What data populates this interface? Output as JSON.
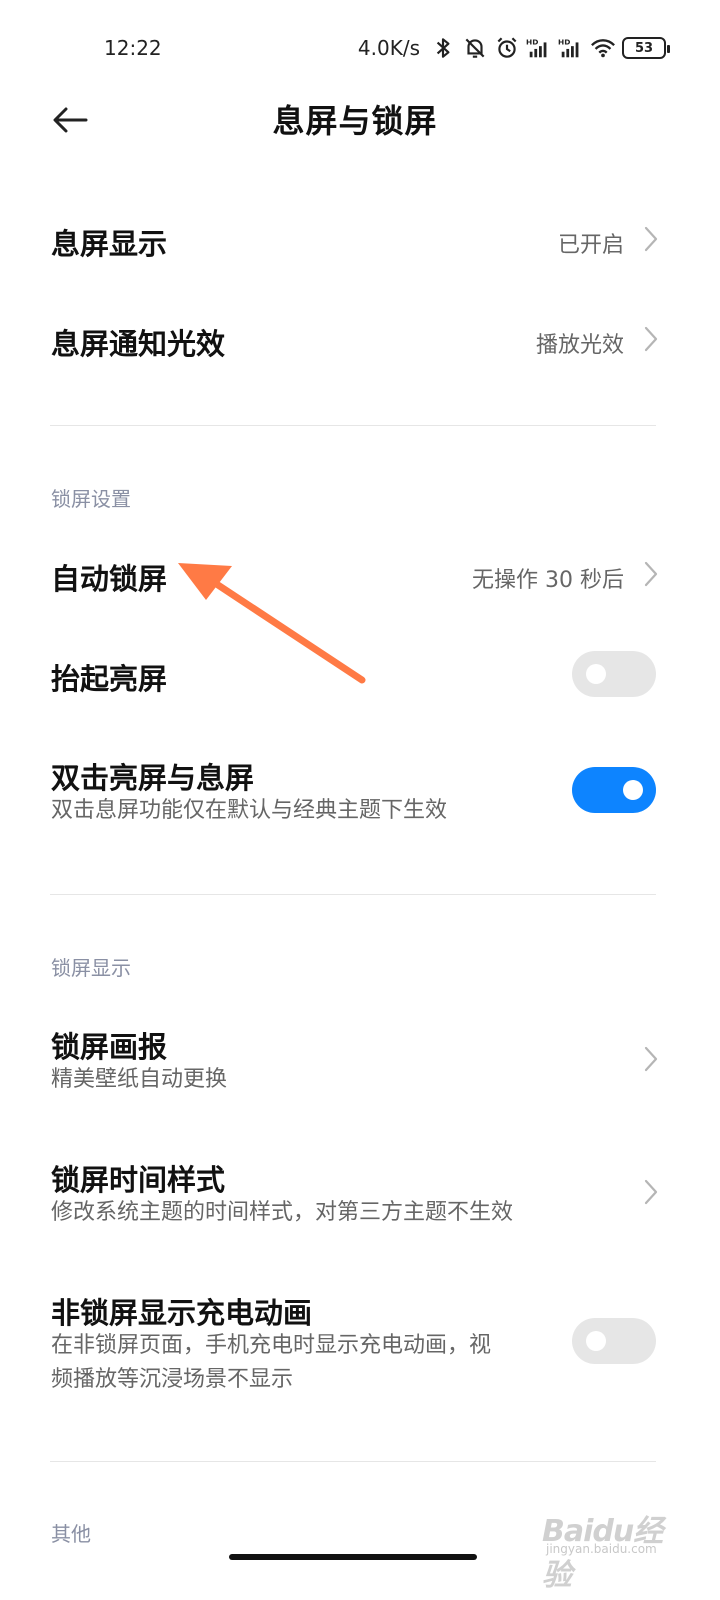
{
  "status_bar": {
    "time": "12:22",
    "net_speed": "4.0K/s",
    "battery": "53",
    "icons": [
      "bluetooth-icon",
      "vibrate-mute-icon",
      "alarm-icon",
      "signal-hd-1-icon",
      "signal-hd-2-icon",
      "wifi-icon"
    ]
  },
  "header": {
    "back_icon": "arrow-left-icon",
    "title": "息屏与锁屏"
  },
  "sections": {
    "aod": {
      "items": [
        {
          "title": "息屏显示",
          "value": "已开启"
        },
        {
          "title": "息屏通知光效",
          "value": "播放光效"
        }
      ]
    },
    "lock_settings": {
      "header": "锁屏设置",
      "items": [
        {
          "title": "自动锁屏",
          "value": "无操作 30 秒后"
        },
        {
          "title": "抬起亮屏",
          "toggle": false
        },
        {
          "title": "双击亮屏与息屏",
          "subtitle": "双击息屏功能仅在默认与经典主题下生效",
          "toggle": true
        }
      ]
    },
    "lock_display": {
      "header": "锁屏显示",
      "items": [
        {
          "title": "锁屏画报",
          "subtitle": "精美壁纸自动更换"
        },
        {
          "title": "锁屏时间样式",
          "subtitle": "修改系统主题的时间样式，对第三方主题不生效"
        },
        {
          "title": "非锁屏显示充电动画",
          "subtitle_line1": "在非锁屏页面，手机充电时显示充电动画，视",
          "subtitle_line2": "频播放等沉浸场景不显示",
          "toggle": false
        }
      ]
    },
    "other": {
      "header": "其他"
    }
  },
  "colors": {
    "accent": "#0d84ff",
    "annotation_arrow": "#ff7a45",
    "section_header": "#8a90a4",
    "toggle_off": "#e6e6e6"
  },
  "watermark": {
    "text": "Baidu经验",
    "sub": "jingyan.baidu.com"
  }
}
